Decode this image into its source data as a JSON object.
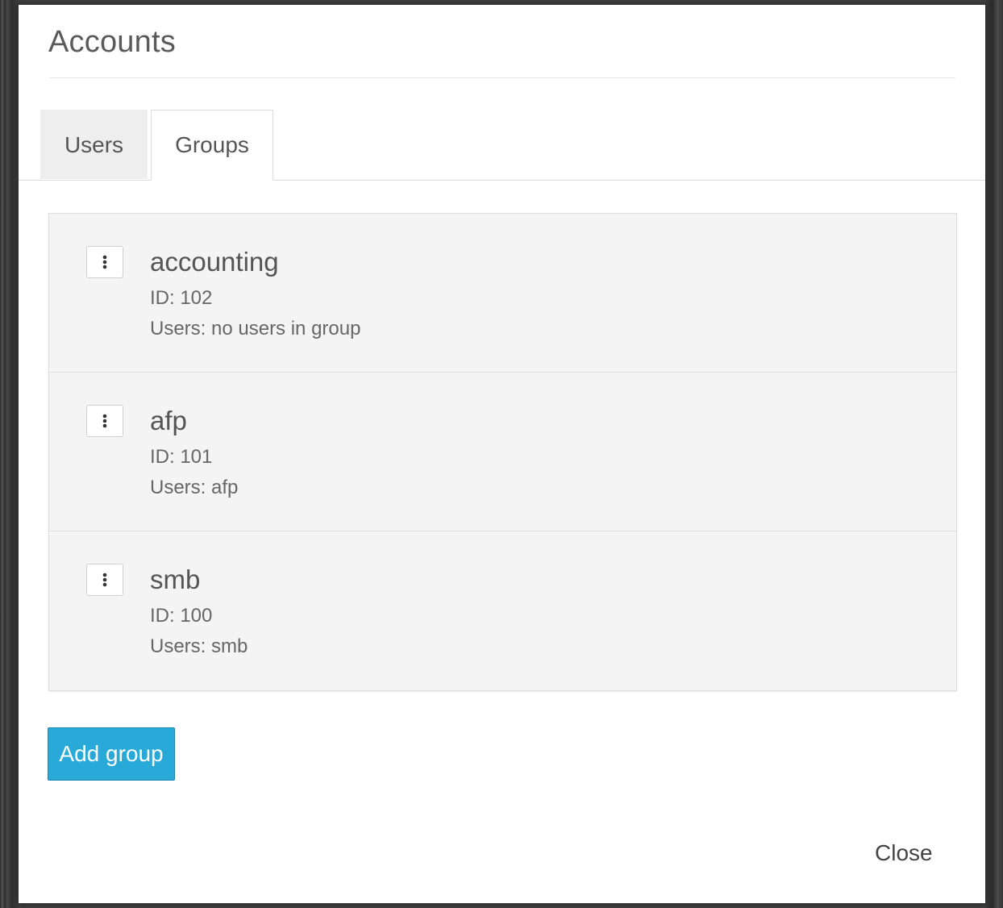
{
  "dialog": {
    "title": "Accounts",
    "close_label": "Close"
  },
  "tabs": [
    {
      "label": "Users",
      "active": false
    },
    {
      "label": "Groups",
      "active": true
    }
  ],
  "groups": [
    {
      "name": "accounting",
      "id": "ID: 102",
      "users": "Users: no users in group"
    },
    {
      "name": "afp",
      "id": "ID: 101",
      "users": "Users: afp"
    },
    {
      "name": "smb",
      "id": "ID: 100",
      "users": "Users: smb"
    }
  ],
  "actions": {
    "add_group_label": "Add group"
  },
  "icons": {
    "menu": "vertical-ellipsis-icon"
  },
  "colors": {
    "primary": "#29a9d7",
    "panel": "#f4f4f4",
    "active_tab": "#ffffff",
    "inactive_tab": "#eeeeee"
  }
}
